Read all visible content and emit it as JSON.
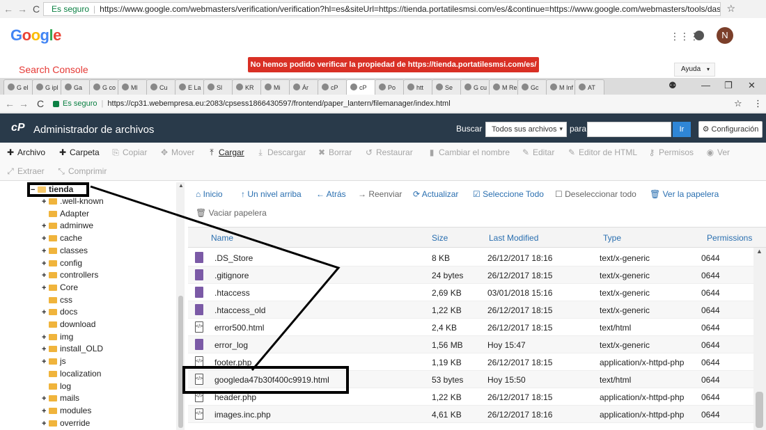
{
  "browser": {
    "outer_secure_label": "Es seguro",
    "outer_url": "https://www.google.com/webmasters/verification/verification?hl=es&siteUrl=https://tienda.portatilesmsi.com/es/&continue=https://www.google.com/webmasters/tools/dashbo...",
    "inner_secure_label": "Es seguro",
    "inner_url": "https://cp31.webempresa.eu:2083/cpsess1866430597/frontend/paper_lantern/filemanager/index.html",
    "tabs": [
      "G el",
      "G ipl",
      "Ga",
      "G co",
      "Ml",
      "Cu",
      "E La",
      "Sl",
      "KR",
      "Mi",
      "Ár",
      "cP",
      "cP",
      "Po",
      "htt",
      "Se",
      "G cu",
      "M Re",
      "Gc",
      "M Inf",
      "AT"
    ]
  },
  "google": {
    "logo_letters": [
      "G",
      "o",
      "o",
      "g",
      "l",
      "e"
    ],
    "logo_colors": [
      "#4285f4",
      "#ea4335",
      "#fbbc05",
      "#4285f4",
      "#34a853",
      "#ea4335"
    ],
    "avatar_letter": "N",
    "search_console": "Search Console",
    "error_banner": "No hemos podido verificar la propiedad de https://tienda.portatilesmsi.com/es/",
    "help_button": "Ayuda"
  },
  "cpanel": {
    "logo": "cP",
    "title": "Administrador de archivos",
    "search_label": "Buscar",
    "search_scope": "Todos sus archivos",
    "para_label": "para",
    "go_button": "Ir",
    "config_button": "Configuración"
  },
  "toolbar": {
    "archivo": "Archivo",
    "carpeta": "Carpeta",
    "copiar": "Copiar",
    "mover": "Mover",
    "cargar": "Cargar",
    "descargar": "Descargar",
    "borrar": "Borrar",
    "restaurar": "Restaurar",
    "cambiar_nombre": "Cambiar el nombre",
    "editar": "Editar",
    "editor_html": "Editor de HTML",
    "permisos": "Permisos",
    "ver": "Ver",
    "extraer": "Extraer",
    "comprimir": "Comprimir"
  },
  "tree": {
    "root": "tienda",
    "items": [
      {
        "name": ".well-known",
        "expandable": true
      },
      {
        "name": "Adapter",
        "expandable": false
      },
      {
        "name": "adminwe",
        "expandable": true
      },
      {
        "name": "cache",
        "expandable": true
      },
      {
        "name": "classes",
        "expandable": true
      },
      {
        "name": "config",
        "expandable": true
      },
      {
        "name": "controllers",
        "expandable": true
      },
      {
        "name": "Core",
        "expandable": true
      },
      {
        "name": "css",
        "expandable": false
      },
      {
        "name": "docs",
        "expandable": true
      },
      {
        "name": "download",
        "expandable": false
      },
      {
        "name": "img",
        "expandable": true
      },
      {
        "name": "install_OLD",
        "expandable": true
      },
      {
        "name": "js",
        "expandable": true
      },
      {
        "name": "localization",
        "expandable": false
      },
      {
        "name": "log",
        "expandable": false
      },
      {
        "name": "mails",
        "expandable": true
      },
      {
        "name": "modules",
        "expandable": true
      },
      {
        "name": "override",
        "expandable": true
      }
    ]
  },
  "main_nav": {
    "inicio": "Inicio",
    "nivel_arriba": "Un nivel arriba",
    "atras": "Atrás",
    "reenviar": "Reenviar",
    "actualizar": "Actualizar",
    "seleccione_todo": "Seleccione Todo",
    "deseleccionar": "Deseleccionar todo",
    "ver_papelera": "Ver la papelera",
    "vaciar_papelera": "Vaciar papelera"
  },
  "table": {
    "headers": {
      "name": "Name",
      "size": "Size",
      "modified": "Last Modified",
      "type": "Type",
      "perms": "Permissions"
    },
    "rows": [
      {
        "icon": "generic",
        "name": ".DS_Store",
        "size": "8 KB",
        "modified": "26/12/2017 18:16",
        "type": "text/x-generic",
        "perms": "0644"
      },
      {
        "icon": "generic",
        "name": ".gitignore",
        "size": "24 bytes",
        "modified": "26/12/2017 18:15",
        "type": "text/x-generic",
        "perms": "0644"
      },
      {
        "icon": "generic",
        "name": ".htaccess",
        "size": "2,69 KB",
        "modified": "03/01/2018 15:16",
        "type": "text/x-generic",
        "perms": "0644"
      },
      {
        "icon": "generic",
        "name": ".htaccess_old",
        "size": "1,22 KB",
        "modified": "26/12/2017 18:15",
        "type": "text/x-generic",
        "perms": "0644"
      },
      {
        "icon": "html",
        "name": "error500.html",
        "size": "2,4 KB",
        "modified": "26/12/2017 18:15",
        "type": "text/html",
        "perms": "0644"
      },
      {
        "icon": "generic",
        "name": "error_log",
        "size": "1,56 MB",
        "modified": "Hoy 15:47",
        "type": "text/x-generic",
        "perms": "0644"
      },
      {
        "icon": "html",
        "name": "footer.php",
        "size": "1,19 KB",
        "modified": "26/12/2017 18:15",
        "type": "application/x-httpd-php",
        "perms": "0644"
      },
      {
        "icon": "html",
        "name": "googleda47b30f400c9919.html",
        "size": "53 bytes",
        "modified": "Hoy 15:50",
        "type": "text/html",
        "perms": "0644"
      },
      {
        "icon": "html",
        "name": "header.php",
        "size": "1,22 KB",
        "modified": "26/12/2017 18:15",
        "type": "application/x-httpd-php",
        "perms": "0644"
      },
      {
        "icon": "html",
        "name": "images.inc.php",
        "size": "4,61 KB",
        "modified": "26/12/2017 18:16",
        "type": "application/x-httpd-php",
        "perms": "0644"
      }
    ]
  }
}
